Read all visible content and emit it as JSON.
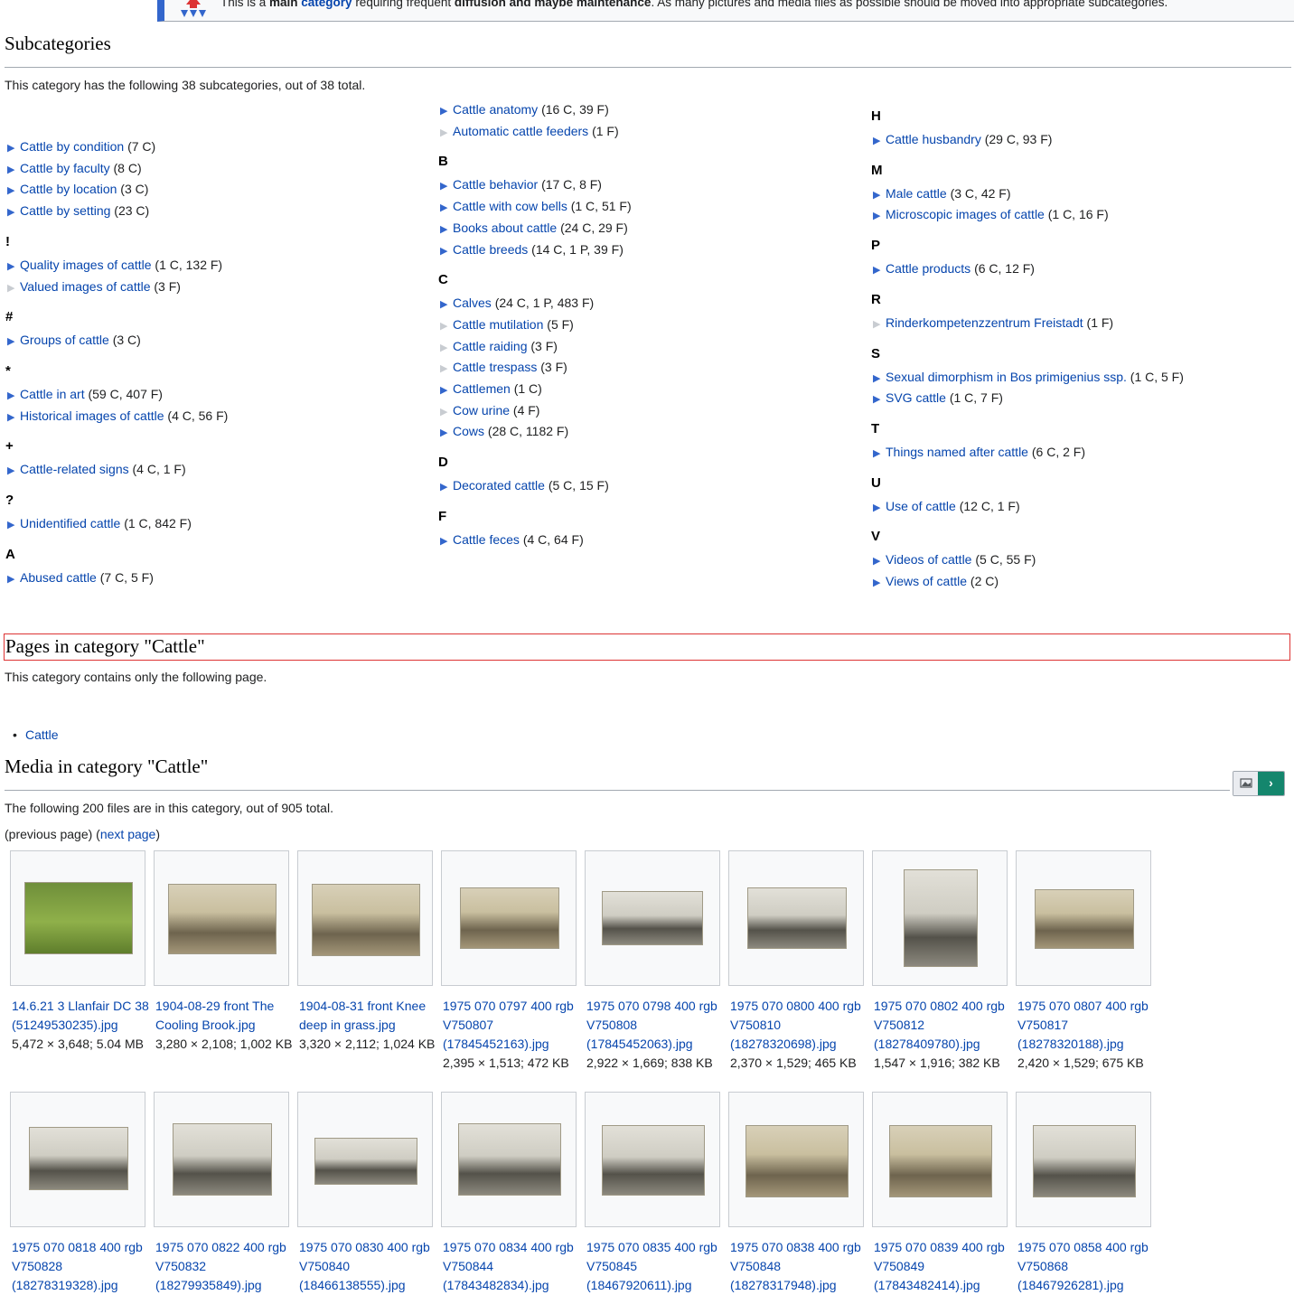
{
  "notice": {
    "text_prefix": "This is a ",
    "bold1": "main ",
    "link": "category",
    "mid": " requiring frequent ",
    "bold2": "diffusion and maybe maintenance",
    "suffix": ". As many pictures and media files as possible should be moved into appropriate subcategories."
  },
  "subcategories": {
    "heading": "Subcategories",
    "description": "This category has the following 38 subcategories, out of 38 total.",
    "columns": [
      [
        {
          "type": "item",
          "label": "Cattle by condition",
          "count": "(7 C)",
          "expandable": true
        },
        {
          "type": "item",
          "label": "Cattle by faculty",
          "count": "(8 C)",
          "expandable": true
        },
        {
          "type": "item",
          "label": "Cattle by location",
          "count": "(3 C)",
          "expandable": true
        },
        {
          "type": "item",
          "label": "Cattle by setting",
          "count": "(23 C)",
          "expandable": true
        },
        {
          "type": "letter",
          "label": "!"
        },
        {
          "type": "item",
          "label": "Quality images of cattle",
          "count": "(1 C, 132 F)",
          "expandable": true
        },
        {
          "type": "item",
          "label": "Valued images of cattle",
          "count": "(3 F)",
          "expandable": false
        },
        {
          "type": "letter",
          "label": "#"
        },
        {
          "type": "item",
          "label": "Groups of cattle",
          "count": "(3 C)",
          "expandable": true
        },
        {
          "type": "letter",
          "label": "*"
        },
        {
          "type": "item",
          "label": "Cattle in art",
          "count": "(59 C, 407 F)",
          "expandable": true
        },
        {
          "type": "item",
          "label": "Historical images of cattle",
          "count": "(4 C, 56 F)",
          "expandable": true
        },
        {
          "type": "letter",
          "label": "+"
        },
        {
          "type": "item",
          "label": "Cattle-related signs",
          "count": "(4 C, 1 F)",
          "expandable": true
        },
        {
          "type": "letter",
          "label": "?"
        },
        {
          "type": "item",
          "label": "Unidentified cattle",
          "count": "(1 C, 842 F)",
          "expandable": true
        },
        {
          "type": "letter",
          "label": "A"
        },
        {
          "type": "item",
          "label": "Abused cattle",
          "count": "(7 C, 5 F)",
          "expandable": true
        }
      ],
      [
        {
          "type": "item",
          "label": "Cattle anatomy",
          "count": "(16 C, 39 F)",
          "expandable": true
        },
        {
          "type": "item",
          "label": "Automatic cattle feeders",
          "count": "(1 F)",
          "expandable": false
        },
        {
          "type": "letter",
          "label": "B"
        },
        {
          "type": "item",
          "label": "Cattle behavior",
          "count": "(17 C, 8 F)",
          "expandable": true
        },
        {
          "type": "item",
          "label": "Cattle with cow bells",
          "count": "(1 C, 51 F)",
          "expandable": true
        },
        {
          "type": "item",
          "label": "Books about cattle",
          "count": "(24 C, 29 F)",
          "expandable": true
        },
        {
          "type": "item",
          "label": "Cattle breeds",
          "count": "(14 C, 1 P, 39 F)",
          "expandable": true
        },
        {
          "type": "letter",
          "label": "C"
        },
        {
          "type": "item",
          "label": "Calves",
          "count": "(24 C, 1 P, 483 F)",
          "expandable": true
        },
        {
          "type": "item",
          "label": "Cattle mutilation",
          "count": "(5 F)",
          "expandable": false
        },
        {
          "type": "item",
          "label": "Cattle raiding",
          "count": "(3 F)",
          "expandable": false
        },
        {
          "type": "item",
          "label": "Cattle trespass",
          "count": "(3 F)",
          "expandable": false
        },
        {
          "type": "item",
          "label": "Cattlemen",
          "count": "(1 C)",
          "expandable": true
        },
        {
          "type": "item",
          "label": "Cow urine",
          "count": "(4 F)",
          "expandable": false
        },
        {
          "type": "item",
          "label": "Cows",
          "count": "(28 C, 1182 F)",
          "expandable": true
        },
        {
          "type": "letter",
          "label": "D"
        },
        {
          "type": "item",
          "label": "Decorated cattle",
          "count": "(5 C, 15 F)",
          "expandable": true
        },
        {
          "type": "letter",
          "label": "F"
        },
        {
          "type": "item",
          "label": "Cattle feces",
          "count": "(4 C, 64 F)",
          "expandable": true
        }
      ],
      [
        {
          "type": "letter",
          "label": "H"
        },
        {
          "type": "item",
          "label": "Cattle husbandry",
          "count": "(29 C, 93 F)",
          "expandable": true
        },
        {
          "type": "letter",
          "label": "M"
        },
        {
          "type": "item",
          "label": "Male cattle",
          "count": "(3 C, 42 F)",
          "expandable": true
        },
        {
          "type": "item",
          "label": "Microscopic images of cattle",
          "count": "(1 C, 16 F)",
          "expandable": true
        },
        {
          "type": "letter",
          "label": "P"
        },
        {
          "type": "item",
          "label": "Cattle products",
          "count": "(6 C, 12 F)",
          "expandable": true
        },
        {
          "type": "letter",
          "label": "R"
        },
        {
          "type": "item",
          "label": "Rinderkompetenzzentrum Freistadt",
          "count": "(1 F)",
          "expandable": false
        },
        {
          "type": "letter",
          "label": "S"
        },
        {
          "type": "item",
          "label": "Sexual dimorphism in Bos primigenius ssp.",
          "count": "(1 C, 5 F)",
          "expandable": true
        },
        {
          "type": "item",
          "label": "SVG cattle",
          "count": "(1 C, 7 F)",
          "expandable": true
        },
        {
          "type": "letter",
          "label": "T"
        },
        {
          "type": "item",
          "label": "Things named after cattle",
          "count": "(6 C, 2 F)",
          "expandable": true
        },
        {
          "type": "letter",
          "label": "U"
        },
        {
          "type": "item",
          "label": "Use of cattle",
          "count": "(12 C, 1 F)",
          "expandable": true
        },
        {
          "type": "letter",
          "label": "V"
        },
        {
          "type": "item",
          "label": "Videos of cattle",
          "count": "(5 C, 55 F)",
          "expandable": true
        },
        {
          "type": "item",
          "label": "Views of cattle",
          "count": "(2 C)",
          "expandable": true
        }
      ]
    ]
  },
  "pages": {
    "heading": "Pages in category \"Cattle\"",
    "description": "This category contains only the following page.",
    "items": [
      "Cattle"
    ]
  },
  "media": {
    "heading": "Media in category \"Cattle\"",
    "description": "The following 200 files are in this category, out of 905 total.",
    "prev_label": "(previous page)",
    "next_open": "(",
    "next_label": "next page",
    "next_close": ")",
    "files": [
      {
        "name": "14.6.21 3 Llanfair DC 38 (51249530235).jpg",
        "meta": "5,472 × 3,648; 5.04 MB",
        "tone": "color"
      },
      {
        "name": "1904-08-29 front The Cooling Brook.jpg",
        "meta": "3,280 × 2,108; 1,002 KB",
        "tone": "sepia"
      },
      {
        "name": "1904-08-31 front Knee deep in grass.jpg",
        "meta": "3,320 × 2,112; 1,024 KB",
        "tone": "sepia"
      },
      {
        "name": "1975 070 0797 400 rgb V750807 (17845452163).jpg",
        "meta": "2,395 × 1,513; 472 KB",
        "tone": "sepia"
      },
      {
        "name": "1975 070 0798 400 rgb V750808 (17845452063).jpg",
        "meta": "2,922 × 1,669; 838 KB",
        "tone": "gray"
      },
      {
        "name": "1975 070 0800 400 rgb V750810 (18278320698).jpg",
        "meta": "2,370 × 1,529; 465 KB",
        "tone": "gray"
      },
      {
        "name": "1975 070 0802 400 rgb V750812 (18278409780).jpg",
        "meta": "1,547 × 1,916; 382 KB",
        "tone": "gray"
      },
      {
        "name": "1975 070 0807 400 rgb V750817 (18278320188).jpg",
        "meta": "2,420 × 1,529; 675 KB",
        "tone": "sepia"
      },
      {
        "name": "1975 070 0818 400 rgb V750828 (18278319328).jpg",
        "meta": "",
        "tone": "gray"
      },
      {
        "name": "1975 070 0822 400 rgb V750832 (18279935849).jpg",
        "meta": "",
        "tone": "gray"
      },
      {
        "name": "1975 070 0830 400 rgb V750840 (18466138555).jpg",
        "meta": "",
        "tone": "gray"
      },
      {
        "name": "1975 070 0834 400 rgb V750844 (17843482834).jpg",
        "meta": "",
        "tone": "gray"
      },
      {
        "name": "1975 070 0835 400 rgb V750845 (18467920611).jpg",
        "meta": "",
        "tone": "gray"
      },
      {
        "name": "1975 070 0838 400 rgb V750848 (18278317948).jpg",
        "meta": "",
        "tone": "sepia"
      },
      {
        "name": "1975 070 0839 400 rgb V750849 (17843482414).jpg",
        "meta": "",
        "tone": "sepia"
      },
      {
        "name": "1975 070 0858 400 rgb V750868 (18467926281).jpg",
        "meta": "",
        "tone": "gray"
      }
    ]
  }
}
